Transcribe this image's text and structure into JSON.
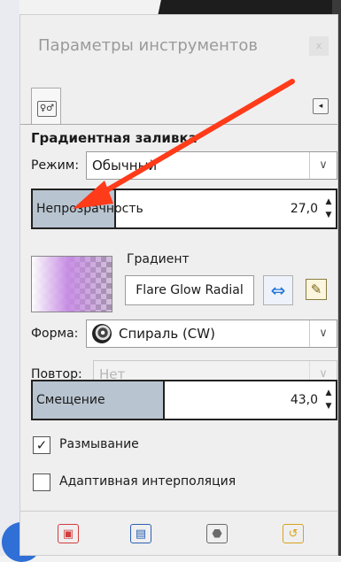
{
  "window": {
    "title": "Параметры инструментов",
    "close_label": "x"
  },
  "tabs": {
    "active_icon": "tool-options-icon",
    "menu_icon": "tab-menu-icon",
    "active_glyph": "♀♂",
    "menu_glyph": "◂"
  },
  "tool": {
    "name": "Градиентная заливка"
  },
  "mode": {
    "label": "Режим:",
    "value": "Обычный"
  },
  "opacity": {
    "label": "Непрозрачность",
    "value": "27,0",
    "fraction": 0.27
  },
  "gradient": {
    "label": "Градиент",
    "name": "Flare Glow Radial",
    "swap_icon": "swap-direction-icon",
    "edit_icon": "edit-gradient-icon",
    "swap_glyph": "⇔",
    "edit_glyph": "✎"
  },
  "shape": {
    "label": "Форма:",
    "value": "Спираль (CW)"
  },
  "repeat": {
    "label": "Повтор:",
    "value": "Нет",
    "enabled": false
  },
  "offset": {
    "label": "Смещение",
    "value": "43,0",
    "fraction": 0.43
  },
  "dither": {
    "label": "Размывание",
    "checked": true
  },
  "adaptive": {
    "label": "Адаптивная интерполяция",
    "checked": false
  },
  "bottom_toolbar": [
    {
      "icon": "save-preset-icon",
      "glyph": "▣",
      "color": "#d23c3c"
    },
    {
      "icon": "restore-preset-icon",
      "glyph": "▤",
      "color": "#2d5fb0"
    },
    {
      "icon": "delete-preset-icon",
      "glyph": "⬣",
      "color": "#6a6a6a"
    },
    {
      "icon": "reset-icon",
      "glyph": "↺",
      "color": "#d9a21a"
    }
  ],
  "annotation": {
    "arrow_color": "#ff3b1a"
  },
  "dropdown_arrow_glyph": "∨",
  "check_glyph": "✓",
  "spin_up_glyph": "▲",
  "spin_down_glyph": "▼"
}
